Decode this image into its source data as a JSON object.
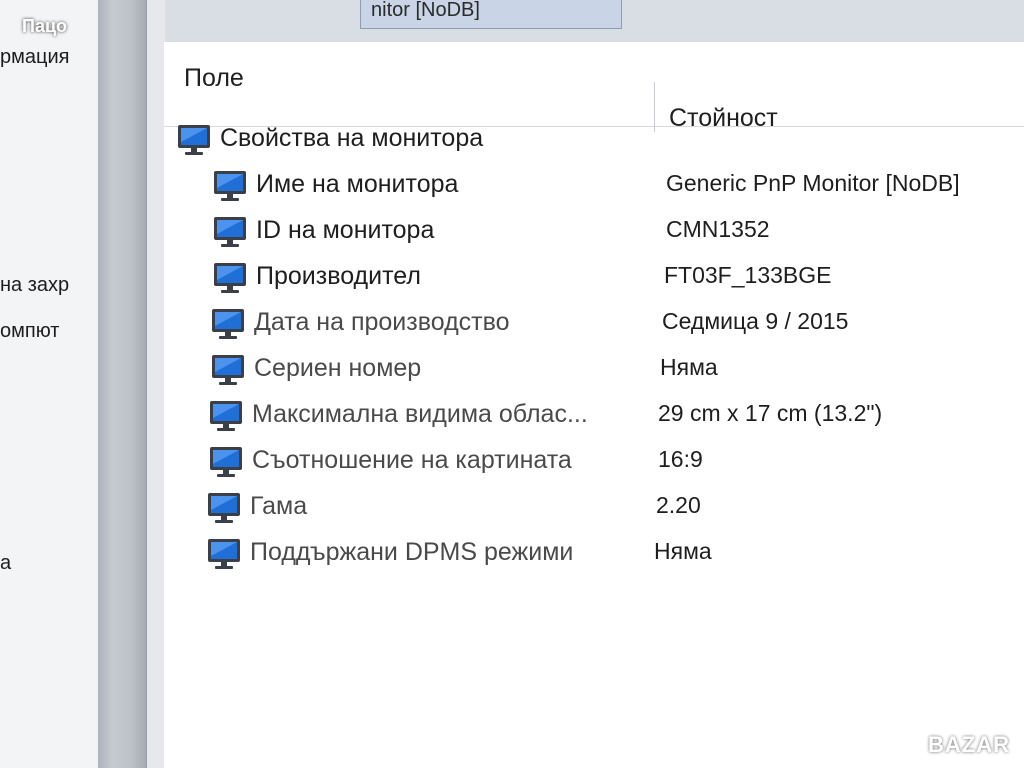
{
  "watermark": {
    "user": "Пацо",
    "brand": "BAZAR"
  },
  "window": {
    "title_fragment": "nitor [NoDB]"
  },
  "left_panel": {
    "fragments": [
      "рмация",
      "на захр",
      "омпют",
      "а"
    ]
  },
  "list": {
    "columns": {
      "field": "Поле",
      "value": "Стойност"
    },
    "group": {
      "label": "Свойства на монитора",
      "icon": "monitor-icon"
    },
    "rows": [
      {
        "label": "Име на монитора",
        "value": "Generic PnP Monitor [NoDB]",
        "icon": "monitor-icon"
      },
      {
        "label": "ID на монитора",
        "value": "CMN1352",
        "icon": "monitor-icon"
      },
      {
        "label": "Производител",
        "value": "FT03F_133BGE",
        "icon": "monitor-icon"
      },
      {
        "label": "Дата на производство",
        "value": "Седмица 9 / 2015",
        "icon": "monitor-icon"
      },
      {
        "label": "Сериен номер",
        "value": "Няма",
        "icon": "monitor-icon"
      },
      {
        "label": "Максимална видима облас...",
        "value": "29 cm x 17 cm (13.2\")",
        "icon": "monitor-icon"
      },
      {
        "label": "Съотношение на картината",
        "value": "16:9",
        "icon": "monitor-icon"
      },
      {
        "label": "Гама",
        "value": "2.20",
        "icon": "monitor-icon"
      },
      {
        "label": "Поддържани DPMS режими",
        "value": "Няма",
        "icon": "monitor-icon"
      }
    ]
  },
  "colors": {
    "icon_screen": "#1f6fd6",
    "icon_frame": "#3a3f48",
    "background": "#ffffff"
  }
}
